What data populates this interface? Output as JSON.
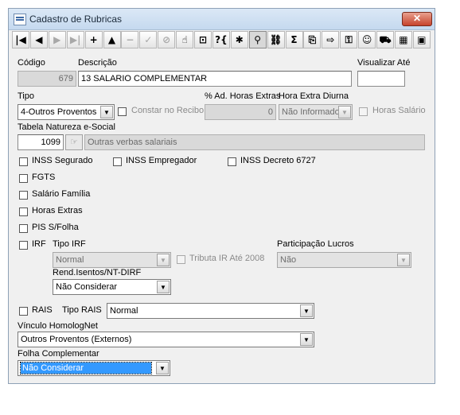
{
  "window": {
    "title": "Cadastro de Rubricas",
    "close_label": "✕"
  },
  "toolbar": {
    "buttons": [
      {
        "name": "first-record-button",
        "glyph": "|◀"
      },
      {
        "name": "prev-record-button",
        "glyph": "◀"
      },
      {
        "name": "next-record-button",
        "glyph": "▶"
      },
      {
        "name": "last-record-button",
        "glyph": "▶|"
      },
      {
        "name": "insert-button",
        "glyph": "+"
      },
      {
        "name": "edit-button",
        "glyph": "▲"
      },
      {
        "name": "delete-button",
        "glyph": "−"
      },
      {
        "name": "post-button",
        "glyph": "✓"
      },
      {
        "name": "cancel-button",
        "glyph": "⊘"
      },
      {
        "name": "hand-button",
        "glyph": "☝"
      },
      {
        "name": "filter-button",
        "glyph": "⊡"
      },
      {
        "name": "query-button",
        "glyph": "?{"
      },
      {
        "name": "tools-button",
        "glyph": "✱"
      },
      {
        "name": "search-button",
        "glyph": "⚲"
      },
      {
        "name": "tree-button",
        "glyph": "⛓"
      },
      {
        "name": "sum-button",
        "glyph": "Σ"
      },
      {
        "name": "copy-button",
        "glyph": "⎘"
      },
      {
        "name": "export-button",
        "glyph": "⇨"
      },
      {
        "name": "key-button",
        "glyph": "⚿"
      },
      {
        "name": "users-button",
        "glyph": "☺"
      },
      {
        "name": "car-button",
        "glyph": "⛟"
      },
      {
        "name": "grid-button",
        "glyph": "▦"
      },
      {
        "name": "exit-button",
        "glyph": "▣"
      }
    ]
  },
  "form": {
    "codigo": {
      "label": "Código",
      "value": "679"
    },
    "descricao": {
      "label": "Descrição",
      "value": "13 SALARIO COMPLEMENTAR"
    },
    "visualizar": {
      "label": "Visualizar Até",
      "value": ""
    },
    "tipo": {
      "label": "Tipo",
      "value": "4-Outros Proventos"
    },
    "constar_recibo": {
      "label": "Constar no Recibo"
    },
    "ad_horas": {
      "label": "% Ad. Horas Extras",
      "value": "0"
    },
    "hora_diurna": {
      "label": "Hora Extra Diurna",
      "value": "Não Informado"
    },
    "horas_salario": {
      "label": "Horas Salário"
    },
    "tabela_natureza": {
      "label": "Tabela Natureza e-Social",
      "code": "1099",
      "text": "Outras verbas salariais"
    },
    "inss_segurado": {
      "label": "INSS Segurado"
    },
    "inss_empregador": {
      "label": "INSS Empregador"
    },
    "inss_decreto": {
      "label": "INSS Decreto 6727"
    },
    "fgts": {
      "label": "FGTS"
    },
    "salario_familia": {
      "label": "Salário Família"
    },
    "horas_extras": {
      "label": "Horas Extras"
    },
    "pis": {
      "label": "PIS S/Folha"
    },
    "irf": {
      "label": "IRF"
    },
    "tipo_irf": {
      "label": "Tipo IRF",
      "value": "Normal"
    },
    "tributa_ir": {
      "label": "Tributa IR Até 2008"
    },
    "participacao": {
      "label": "Participação Lucros",
      "value": "Não"
    },
    "rend_isentos": {
      "label": "Rend.Isentos/NT-DIRF",
      "value": "Não Considerar"
    },
    "rais": {
      "label": "RAIS"
    },
    "tipo_rais": {
      "label": "Tipo RAIS",
      "value": "Normal"
    },
    "vinculo": {
      "label": "Vínculo HomologNet",
      "value": "Outros Proventos (Externos)"
    },
    "folha_comp": {
      "label": "Folha Complementar",
      "value": "Não Considerar"
    }
  }
}
